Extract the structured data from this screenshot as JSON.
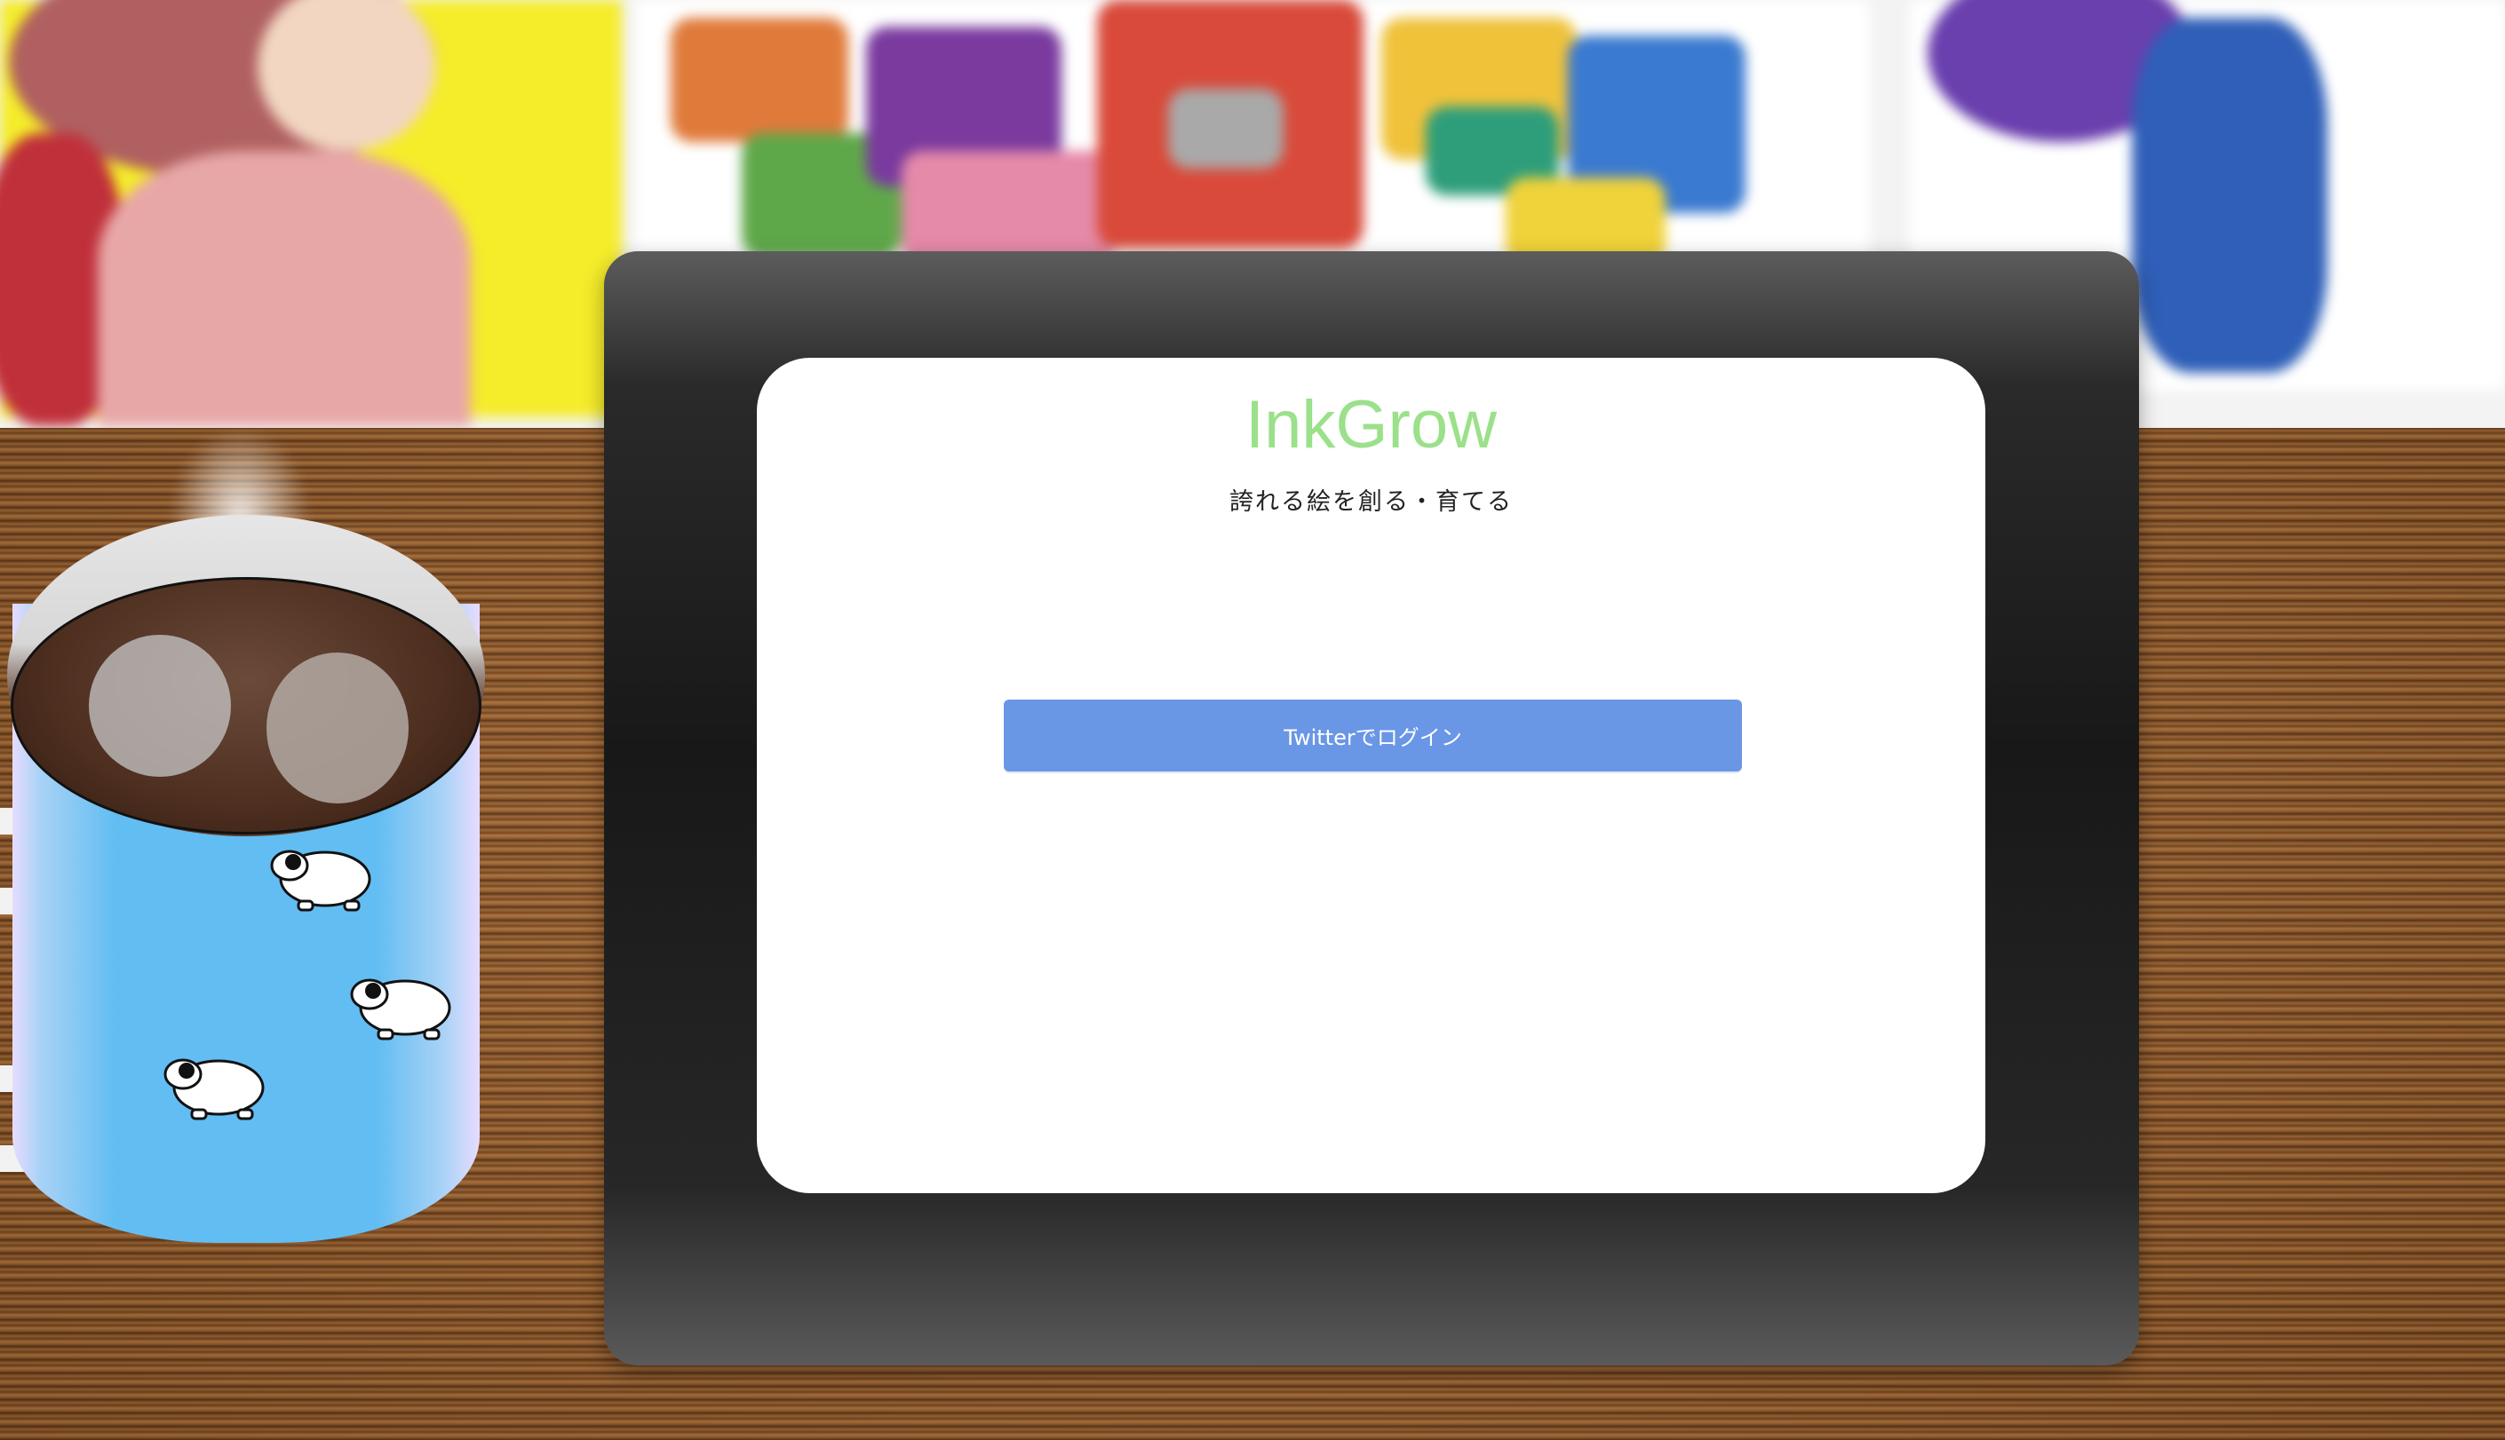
{
  "app": {
    "title": "InkGrow",
    "tagline": "誇れる絵を創る・育てる"
  },
  "login": {
    "button_label": "Twitterでログイン"
  },
  "colors": {
    "title_accent": "#9be08a",
    "button": "#6a96e6",
    "button_text": "#ffffff",
    "screen": "#ffffff",
    "tablet_bezel": "#1c1c1c"
  },
  "scene": {
    "background_icons": [
      "poster-art",
      "wooden-desk",
      "coffee-mug",
      "sheep-icon",
      "drawing-tablet"
    ]
  }
}
